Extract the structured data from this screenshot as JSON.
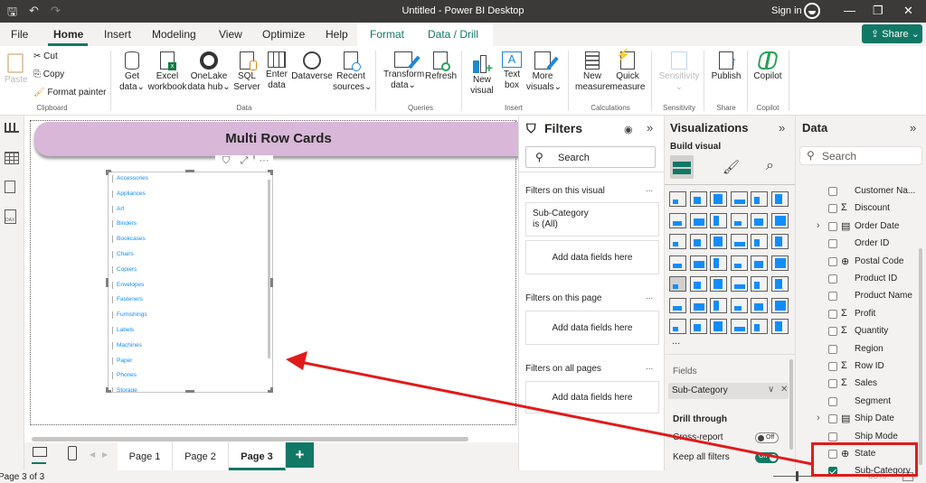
{
  "window": {
    "title": "Untitled - Power BI Desktop",
    "sign_in": "Sign in",
    "share": "Share"
  },
  "menu_tabs": [
    "File",
    "Home",
    "Insert",
    "Modeling",
    "View",
    "Optimize",
    "Help",
    "Format",
    "Data / Drill"
  ],
  "active_tab": "Home",
  "ribbon": {
    "clipboard": {
      "paste": "Paste",
      "cut": "Cut",
      "copy": "Copy",
      "format_painter": "Format painter",
      "group": "Clipboard"
    },
    "data": {
      "get_data": [
        "Get",
        "data"
      ],
      "excel": [
        "Excel",
        "workbook"
      ],
      "onelake": [
        "OneLake",
        "data hub"
      ],
      "sql": [
        "SQL",
        "Server"
      ],
      "enter": [
        "Enter",
        "data"
      ],
      "dataverse": "Dataverse",
      "recent": [
        "Recent",
        "sources"
      ],
      "group": "Data"
    },
    "queries": {
      "transform": [
        "Transform",
        "data"
      ],
      "refresh": "Refresh",
      "group": "Queries"
    },
    "insert": {
      "new_visual": [
        "New",
        "visual"
      ],
      "text_box": [
        "Text",
        "box"
      ],
      "more_visuals": [
        "More",
        "visuals"
      ],
      "group": "Insert"
    },
    "calculations": {
      "new_measure": [
        "New",
        "measure"
      ],
      "quick_measure": [
        "Quick",
        "measure"
      ],
      "group": "Calculations"
    },
    "sensitivity": {
      "label": "Sensitivity",
      "group": "Sensitivity"
    },
    "share": {
      "publish": "Publish",
      "group": "Share"
    },
    "copilot": {
      "label": "Copilot",
      "group": "Copilot"
    }
  },
  "canvas": {
    "banner_title": "Multi Row Cards",
    "card_items": [
      "Accessories",
      "Appliances",
      "Art",
      "Binders",
      "Bookcases",
      "Chairs",
      "Copiers",
      "Envelopes",
      "Fasteners",
      "Furnishings",
      "Labels",
      "Machines",
      "Paper",
      "Phones",
      "Storage"
    ]
  },
  "pages": {
    "tabs": [
      "Page 1",
      "Page 2",
      "Page 3"
    ],
    "active": "Page 3",
    "add": "+",
    "status": "Page 3 of 3",
    "zoom": "38%"
  },
  "filters": {
    "title": "Filters",
    "search": "Search",
    "on_visual": "Filters on this visual",
    "filter_field": "Sub-Category",
    "filter_value": "is (All)",
    "add_fields": "Add data fields here",
    "on_page": "Filters on this page",
    "on_all": "Filters on all pages",
    "more": "..."
  },
  "visualizations": {
    "title": "Visualizations",
    "build_visual": "Build visual",
    "fields_label": "Fields",
    "field_value": "Sub-Category",
    "drill_through": "Drill through",
    "cross_report": "Cross-report",
    "cross_report_state": "Off",
    "keep_filters": "Keep all filters",
    "keep_filters_state": "On",
    "more": "..."
  },
  "data_pane": {
    "title": "Data",
    "search": "Search",
    "fields": [
      {
        "name": "Customer Na...",
        "type": "",
        "checked": false,
        "expand": false
      },
      {
        "name": "Discount",
        "type": "Σ",
        "checked": false,
        "expand": false
      },
      {
        "name": "Order Date",
        "type": "▤",
        "checked": false,
        "expand": true
      },
      {
        "name": "Order ID",
        "type": "",
        "checked": false,
        "expand": false
      },
      {
        "name": "Postal Code",
        "type": "⊕",
        "checked": false,
        "expand": false
      },
      {
        "name": "Product ID",
        "type": "",
        "checked": false,
        "expand": false
      },
      {
        "name": "Product Name",
        "type": "",
        "checked": false,
        "expand": false
      },
      {
        "name": "Profit",
        "type": "Σ",
        "checked": false,
        "expand": false
      },
      {
        "name": "Quantity",
        "type": "Σ",
        "checked": false,
        "expand": false
      },
      {
        "name": "Region",
        "type": "",
        "checked": false,
        "expand": false
      },
      {
        "name": "Row ID",
        "type": "Σ",
        "checked": false,
        "expand": false
      },
      {
        "name": "Sales",
        "type": "Σ",
        "checked": false,
        "expand": false
      },
      {
        "name": "Segment",
        "type": "",
        "checked": false,
        "expand": false
      },
      {
        "name": "Ship Date",
        "type": "▤",
        "checked": false,
        "expand": true
      },
      {
        "name": "Ship Mode",
        "type": "",
        "checked": false,
        "expand": false
      },
      {
        "name": "State",
        "type": "⊕",
        "checked": false,
        "expand": false
      },
      {
        "name": "Sub-Category",
        "type": "",
        "checked": true,
        "expand": false
      }
    ]
  },
  "colors": {
    "accent": "#117865",
    "banner": "#d8b7d8",
    "card_text": "#118dff",
    "annotation": "#e01b1b"
  }
}
